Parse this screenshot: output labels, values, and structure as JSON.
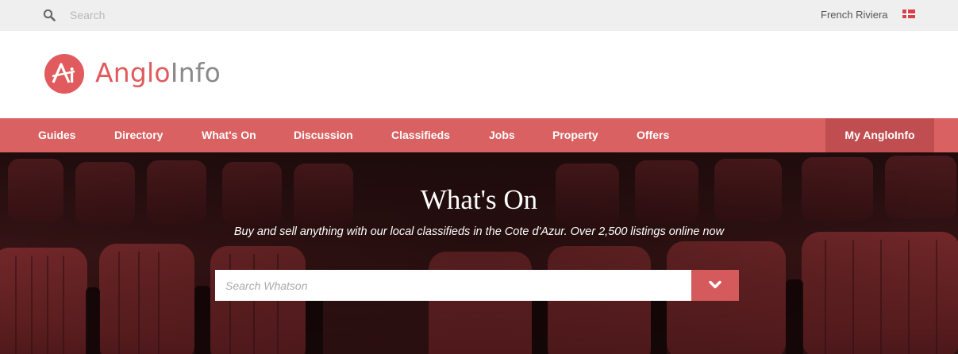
{
  "topbar": {
    "search_placeholder": "Search",
    "region": "French Riviera",
    "icons": {
      "search": "search-icon",
      "flag": "denmark-flag-icon"
    }
  },
  "header": {
    "logo_text_part1": "Anglo",
    "logo_text_part2": "Info",
    "logo_mark": "ai-logo-icon"
  },
  "nav": {
    "items": [
      "Guides",
      "Directory",
      "What's On",
      "Discussion",
      "Classifieds",
      "Jobs",
      "Property",
      "Offers"
    ],
    "account": "My AngloInfo"
  },
  "hero": {
    "title": "What's On",
    "subtitle": "Buy and sell anything with our local classifieds in the Cote d'Azur. Over 2,500 listings online now",
    "search_placeholder": "Search Whatson",
    "dropdown_icon": "chevron-down-icon"
  },
  "colors": {
    "brand": "#d96161",
    "brand_dark": "#c04e50",
    "topbar_bg": "#efefef",
    "hero_bg": "#2a1112"
  }
}
